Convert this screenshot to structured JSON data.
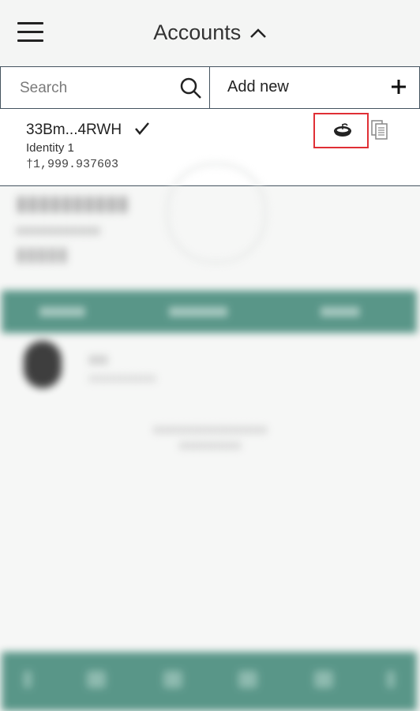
{
  "header": {
    "title": "Accounts",
    "menu_icon": "hamburger-menu-icon",
    "title_icon": "chevron-up-icon"
  },
  "search": {
    "placeholder": "Search",
    "icon": "search-icon"
  },
  "add_new": {
    "label": "Add new",
    "icon": "plus-icon"
  },
  "account": {
    "address": "33Bm...4RWH",
    "name": "Identity 1",
    "balance": "†1,999.937603",
    "active_icon": "check-icon",
    "baker_icon": "baker-icon",
    "copy_icon": "copy-icon"
  },
  "colors": {
    "accent": "#4c8e7f",
    "highlight": "#e02f35",
    "border": "#44535f"
  }
}
